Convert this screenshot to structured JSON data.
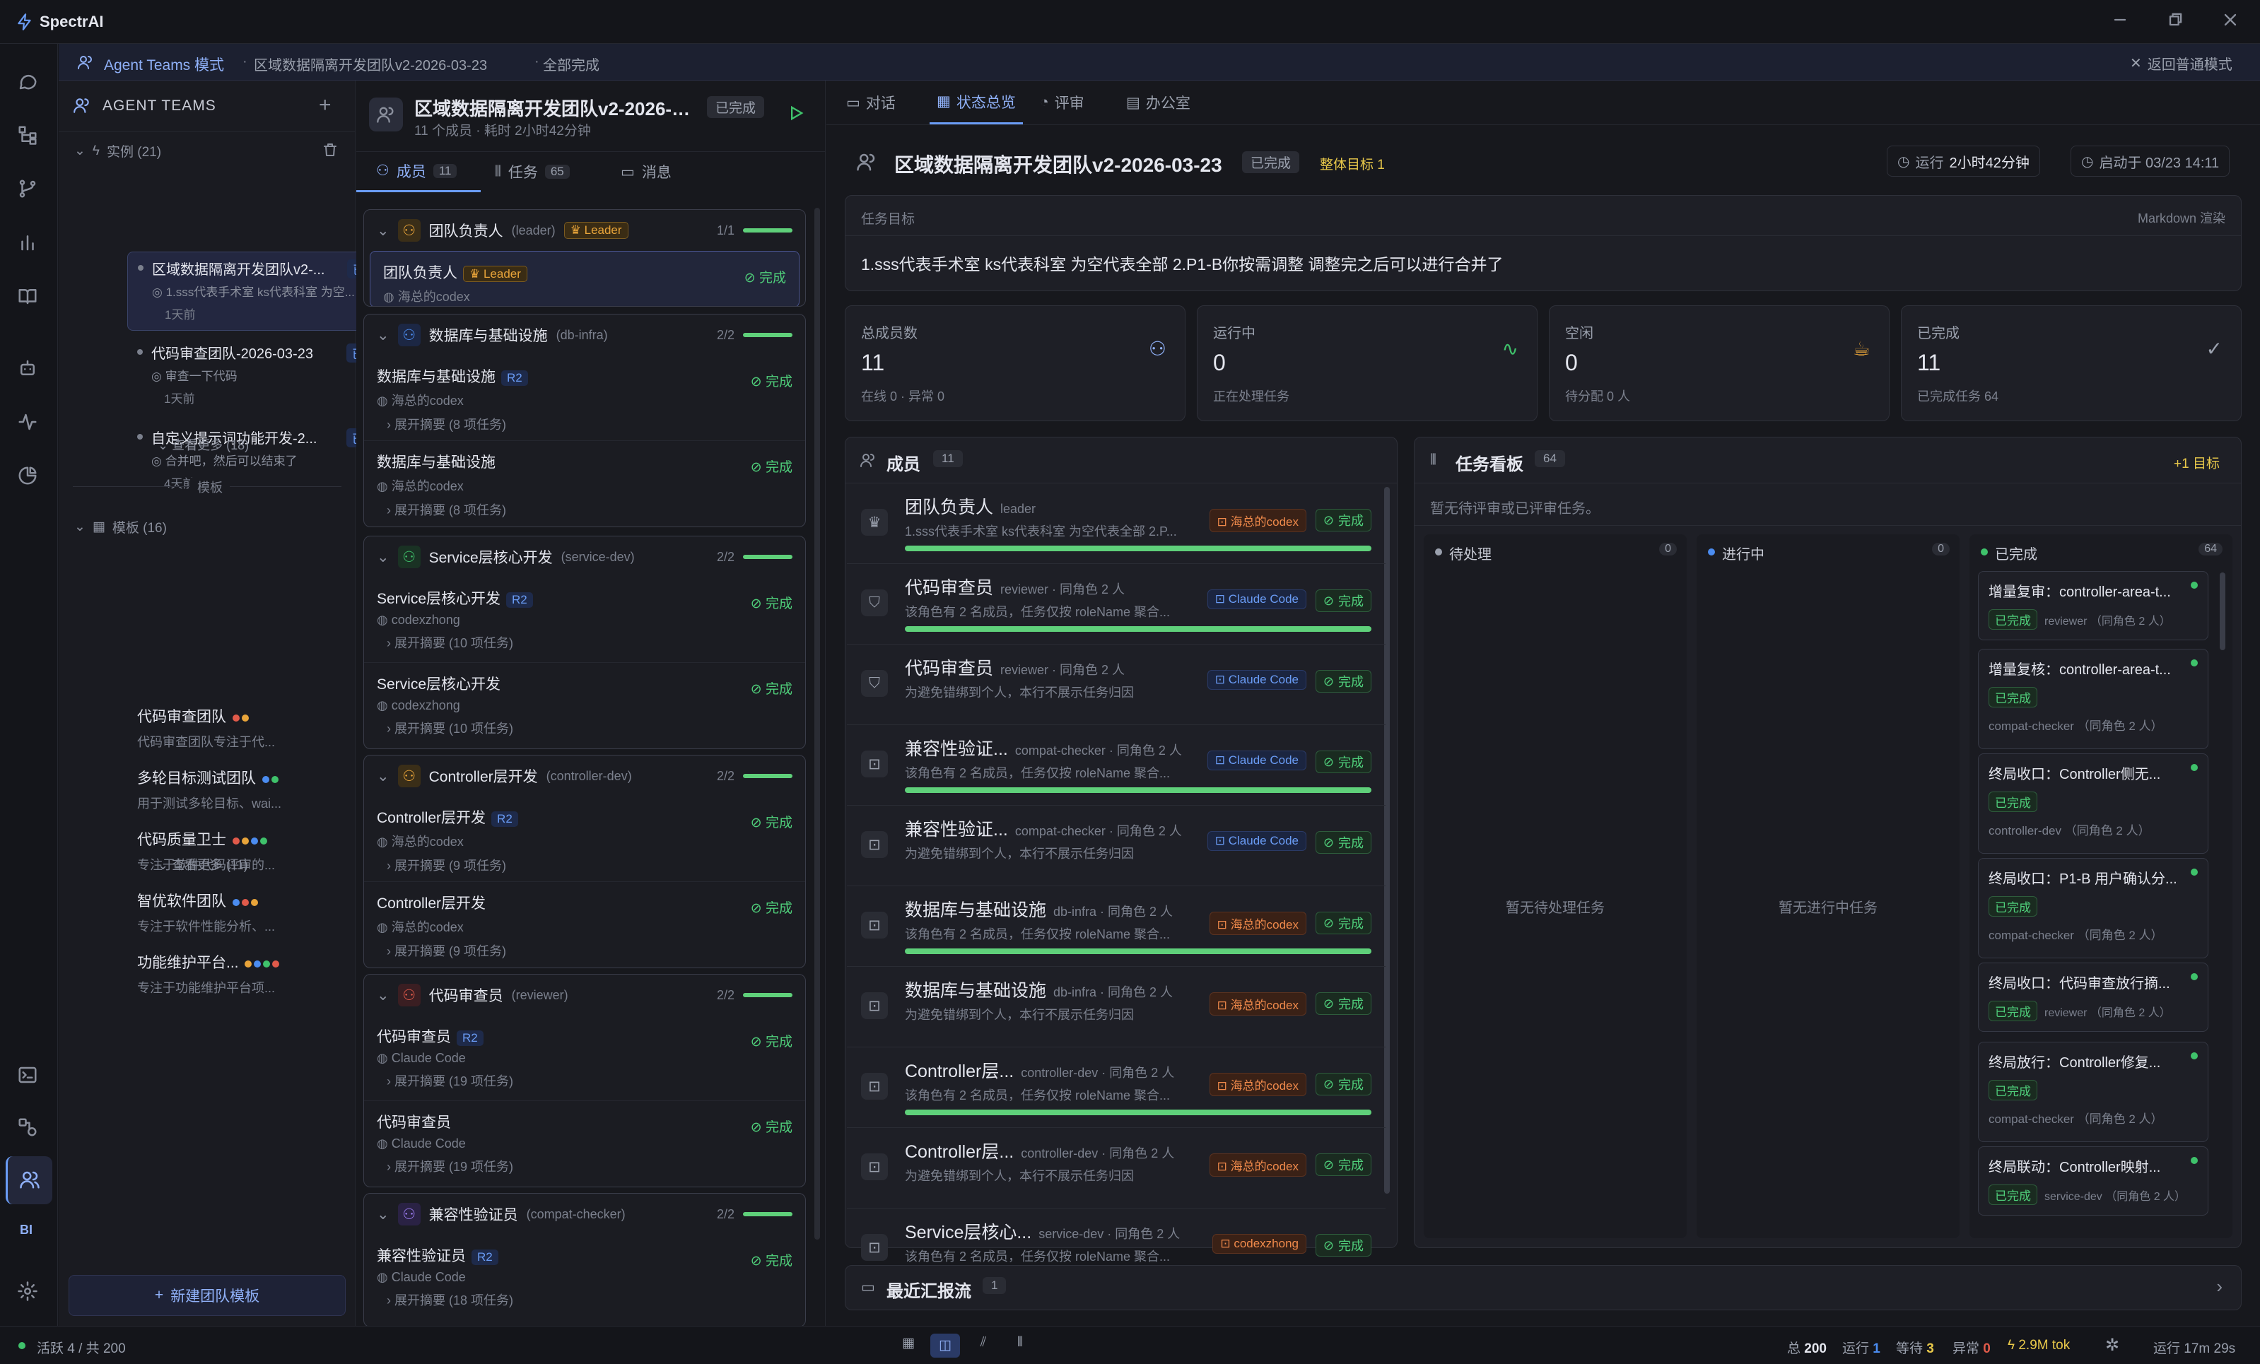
{
  "app": {
    "name": "SpectrAI"
  },
  "banner": {
    "mode": "Agent Teams 模式",
    "sep": "·",
    "team": "区域数据隔离开发团队v2-2026-03-23",
    "state": "全部完成",
    "back": "返回普通模式"
  },
  "sidebar": {
    "title": "AGENT TEAMS",
    "instances_label": "实例 (21)",
    "instances": [
      {
        "name": "区域数据隔离开发团队v2-...",
        "badge": "已完成",
        "desc": "1.sss代表手术室 ks代表科室 为空...",
        "time": "1天前"
      },
      {
        "name": "代码审查团队-2026-03-23",
        "badge": "已完成",
        "desc": "审查一下代码",
        "time": "1天前"
      },
      {
        "name": "自定义提示词功能开发-2...",
        "badge": "已完成",
        "desc": "合并吧，然后可以结束了",
        "time": "4天前"
      }
    ],
    "more_instances": "查看更多 (18)",
    "templates_divider": "模板",
    "templates_label": "模板 (16)",
    "templates": [
      {
        "name": "代码审查团队",
        "desc": "代码审查团队专注于代...",
        "dots": [
          "#e05a4a",
          "#e8a43a"
        ]
      },
      {
        "name": "多轮目标测试团队",
        "desc": "用于测试多轮目标、wai...",
        "dots": [
          "#4b8cf0",
          "#3fc26b"
        ]
      },
      {
        "name": "代码质量卫士",
        "desc": "专注于软件代码评审的...",
        "dots": [
          "#e05a4a",
          "#e8a43a",
          "#4b8cf0",
          "#3fc26b"
        ]
      },
      {
        "name": "智优软件团队",
        "desc": "专注于软件性能分析、...",
        "dots": [
          "#4b8cf0",
          "#e05a4a",
          "#e8a43a"
        ]
      },
      {
        "name": "功能维护平台...",
        "desc": "专注于功能维护平台项...",
        "dots": [
          "#e8a43a",
          "#4b8cf0",
          "#3fc26b",
          "#e05a4a"
        ]
      }
    ],
    "more_templates": "查看更多 (11)",
    "new_button": "新建团队模板"
  },
  "mid": {
    "team_title": "区域数据隔离开发团队v2-2026-03-...",
    "team_state": "已完成",
    "team_meta": "11 个成员 · 耗时 2小时42分钟",
    "tabs": [
      {
        "label": "成员",
        "count": "11"
      },
      {
        "label": "任务",
        "count": "65"
      },
      {
        "label": "消息",
        "count": ""
      }
    ],
    "groups": [
      {
        "name": "团队负责人",
        "code": "(leader)",
        "count": "1/1",
        "leader_tag": "Leader",
        "members": [
          {
            "name": "团队负责人",
            "tag": "Leader",
            "sub": "海总的codex",
            "status": "完成"
          }
        ]
      },
      {
        "name": "数据库与基础设施",
        "code": "(db-infra)",
        "count": "2/2",
        "members": [
          {
            "name": "数据库与基础设施",
            "tag": "R2",
            "sub": "海总的codex",
            "expand": "展开摘要",
            "n": "(8 项任务)",
            "status": "完成"
          },
          {
            "name": "数据库与基础设施",
            "tag": "",
            "sub": "海总的codex",
            "expand": "展开摘要",
            "n": "(8 项任务)",
            "status": "完成"
          }
        ]
      },
      {
        "name": "Service层核心开发",
        "code": "(service-dev)",
        "count": "2/2",
        "members": [
          {
            "name": "Service层核心开发",
            "tag": "R2",
            "sub": "codexzhong",
            "expand": "展开摘要",
            "n": "(10 项任务)",
            "status": "完成"
          },
          {
            "name": "Service层核心开发",
            "tag": "",
            "sub": "codexzhong",
            "expand": "展开摘要",
            "n": "(10 项任务)",
            "status": "完成"
          }
        ]
      },
      {
        "name": "Controller层开发",
        "code": "(controller-dev)",
        "count": "2/2",
        "members": [
          {
            "name": "Controller层开发",
            "tag": "R2",
            "sub": "海总的codex",
            "expand": "展开摘要",
            "n": "(9 项任务)",
            "status": "完成"
          },
          {
            "name": "Controller层开发",
            "tag": "",
            "sub": "海总的codex",
            "expand": "展开摘要",
            "n": "(9 项任务)",
            "status": "完成"
          }
        ]
      },
      {
        "name": "代码审查员",
        "code": "(reviewer)",
        "count": "2/2",
        "members": [
          {
            "name": "代码审查员",
            "tag": "R2",
            "sub": "Claude Code",
            "expand": "展开摘要",
            "n": "(19 项任务)",
            "status": "完成"
          },
          {
            "name": "代码审查员",
            "tag": "",
            "sub": "Claude Code",
            "expand": "展开摘要",
            "n": "(19 项任务)",
            "status": "完成"
          }
        ]
      },
      {
        "name": "兼容性验证员",
        "code": "(compat-checker)",
        "count": "2/2",
        "members": [
          {
            "name": "兼容性验证员",
            "tag": "R2",
            "sub": "Claude Code",
            "expand": "展开摘要",
            "n": "(18 项任务)",
            "status": "完成"
          }
        ]
      }
    ]
  },
  "right": {
    "tabs": [
      "对话",
      "状态总览",
      "评审",
      "办公室"
    ],
    "title": "区域数据隔离开发团队v2-2026-03-23",
    "state": "已完成",
    "goal_count": "整体目标 1",
    "run_label": "运行",
    "run_time": "2小时42分钟",
    "start": "启动于 03/23 14:11",
    "goal_label": "任务目标",
    "goal_md": "Markdown 渲染",
    "goal_text": "1.sss代表手术室 ks代表科室 为空代表全部 2.P1-B你按需调整 调整完之后可以进行合并了",
    "stats": [
      {
        "label": "总成员数",
        "value": "11",
        "sub": "在线 0 · 异常 0"
      },
      {
        "label": "运行中",
        "value": "0",
        "sub": "正在处理任务"
      },
      {
        "label": "空闲",
        "value": "0",
        "sub": "待分配 0 人"
      },
      {
        "label": "已完成",
        "value": "11",
        "sub": "已完成任务 64"
      }
    ],
    "members_title": "成员",
    "members_count": "11",
    "members": [
      {
        "name": "团队负责人",
        "role": "leader",
        "desc": "1.sss代表手术室 ks代表科室 为空代表全部 2.P...",
        "prov": "海总的codex",
        "pk": "o",
        "status": "完成",
        "bar": 1
      },
      {
        "name": "代码审查员",
        "role": "reviewer · 同角色 2 人",
        "desc": "该角色有 2 名成员，任务仅按 roleName 聚合...",
        "prov": "Claude Code",
        "pk": "b",
        "status": "完成",
        "bar": 1
      },
      {
        "name": "代码审查员",
        "role": "reviewer · 同角色 2 人",
        "desc": "为避免错绑到个人，本行不展示任务归因",
        "prov": "Claude Code",
        "pk": "b",
        "status": "完成",
        "bar": 0
      },
      {
        "name": "兼容性验证...",
        "role": "compat-checker · 同角色 2 人",
        "desc": "该角色有 2 名成员，任务仅按 roleName 聚合...",
        "prov": "Claude Code",
        "pk": "b",
        "status": "完成",
        "bar": 1
      },
      {
        "name": "兼容性验证...",
        "role": "compat-checker · 同角色 2 人",
        "desc": "为避免错绑到个人，本行不展示任务归因",
        "prov": "Claude Code",
        "pk": "b",
        "status": "完成",
        "bar": 0
      },
      {
        "name": "数据库与基础设施",
        "role": "db-infra · 同角色 2 人",
        "desc": "该角色有 2 名成员，任务仅按 roleName 聚合...",
        "prov": "海总的codex",
        "pk": "o",
        "status": "完成",
        "bar": 1
      },
      {
        "name": "数据库与基础设施",
        "role": "db-infra · 同角色 2 人",
        "desc": "为避免错绑到个人，本行不展示任务归因",
        "prov": "海总的codex",
        "pk": "o",
        "status": "完成",
        "bar": 0
      },
      {
        "name": "Controller层...",
        "role": "controller-dev · 同角色 2 人",
        "desc": "该角色有 2 名成员，任务仅按 roleName 聚合...",
        "prov": "海总的codex",
        "pk": "o",
        "status": "完成",
        "bar": 1
      },
      {
        "name": "Controller层...",
        "role": "controller-dev · 同角色 2 人",
        "desc": "为避免错绑到个人，本行不展示任务归因",
        "prov": "海总的codex",
        "pk": "o",
        "status": "完成",
        "bar": 0
      },
      {
        "name": "Service层核心...",
        "role": "service-dev · 同角色 2 人",
        "desc": "该角色有 2 名成员，任务仅按 roleName 聚合...",
        "prov": "codexzhong",
        "pk": "o",
        "status": "完成",
        "bar": 1
      }
    ],
    "board_title": "任务看板",
    "board_count": "64",
    "board_goal": "+1 目标",
    "board_note": "暂无待评审或已评审任务。",
    "cols": [
      {
        "label": "待处理",
        "count": "0",
        "empty": "暂无待处理任务",
        "color": "#9aa0ad"
      },
      {
        "label": "进行中",
        "count": "0",
        "empty": "暂无进行中任务",
        "color": "#4b8cf0"
      },
      {
        "label": "已完成",
        "count": "64",
        "empty": "",
        "color": "#3fc26b"
      }
    ],
    "done_cards": [
      {
        "title": "增量复审：controller-area-t...",
        "state": "已完成",
        "who": "reviewer （同角色 2 人）",
        "inline": true
      },
      {
        "title": "增量复核：controller-area-t...",
        "state": "已完成",
        "who": "compat-checker （同角色 2 人）",
        "inline": false
      },
      {
        "title": "终局收口：Controller侧无...",
        "state": "已完成",
        "who": "controller-dev （同角色 2 人）",
        "inline": false
      },
      {
        "title": "终局收口：P1-B 用户确认分...",
        "state": "已完成",
        "who": "compat-checker （同角色 2 人）",
        "inline": false
      },
      {
        "title": "终局收口：代码审查放行摘...",
        "state": "已完成",
        "who": "reviewer （同角色 2 人）",
        "inline": true
      },
      {
        "title": "终局放行：Controller修复...",
        "state": "已完成",
        "who": "compat-checker （同角色 2 人）",
        "inline": false
      },
      {
        "title": "终局联动：Controller映射...",
        "state": "已完成",
        "who": "service-dev （同角色 2 人）",
        "inline": true
      }
    ],
    "reports_title": "最近汇报流",
    "reports_count": "1"
  },
  "status": {
    "active": "活跃 4 / 共 200",
    "total_l": "总",
    "total": "200",
    "run_l": "运行",
    "run": "1",
    "wait_l": "等待",
    "wait": "3",
    "err_l": "异常",
    "err": "0",
    "tok": "2.9M tok",
    "uptime": "运行 17m 29s"
  },
  "rail": {
    "bi": "BI"
  }
}
